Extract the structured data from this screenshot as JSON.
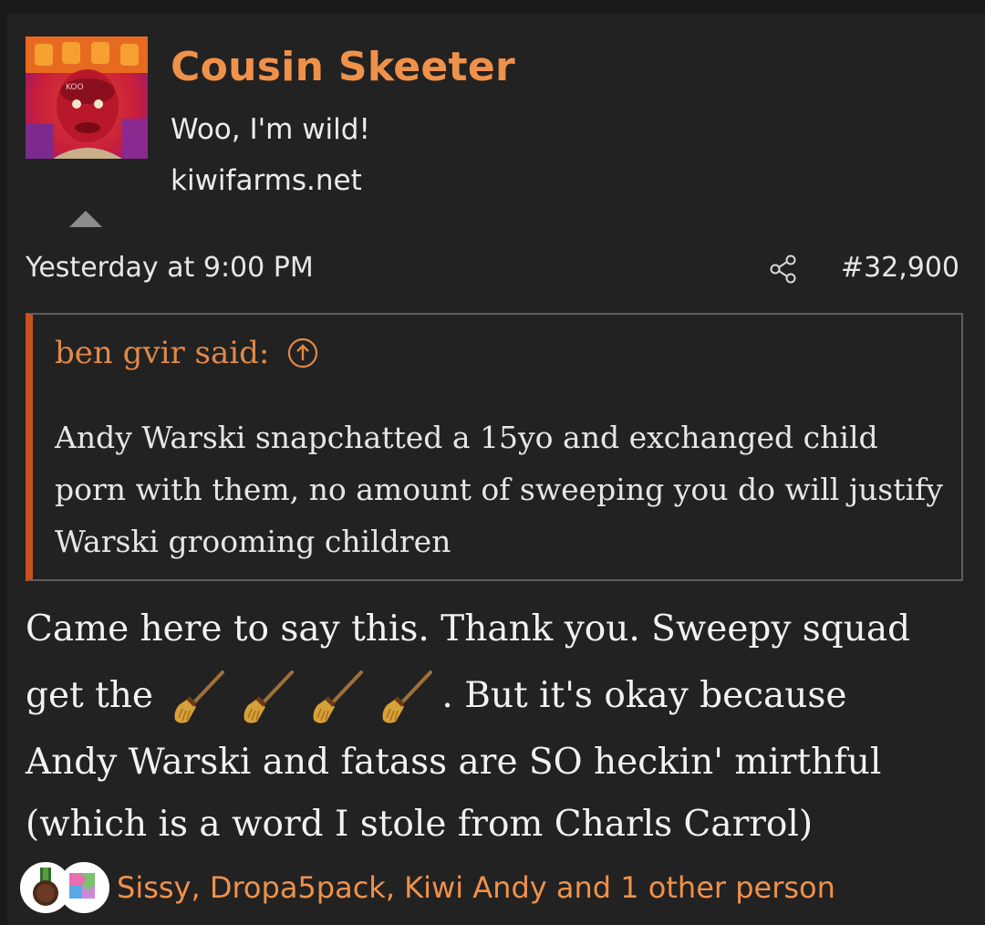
{
  "post": {
    "username": "Cousin Skeeter",
    "user_title": "Woo, I'm wild!",
    "user_site": "kiwifarms.net",
    "timestamp": "Yesterday at 9:00 PM",
    "post_number": "#32,900",
    "avatar_icon": "user-avatar",
    "share_icon": "share-icon"
  },
  "quote": {
    "author_said": "ben gvir said:",
    "jump_icon": "arrow-up-circle-icon",
    "text": "Andy Warski snapchatted a 15yo and exchanged child porn with them, no amount of sweeping you do will justify Warski grooming children",
    "accent_color": "#c9511e"
  },
  "body": {
    "line1": "Came here to say this. Thank you. Sweepy squad",
    "line2_start": "get the",
    "emoji_name": "broom-emoji",
    "emoji_count": 4,
    "line2_end": ". But it's okay because",
    "line3": "Andy Warski and fatass are SO heckin' mirthful",
    "line4": "(which is a word I stole from Charls Carrol)"
  },
  "reactions": {
    "summary": "Sissy, Dropa5pack, Kiwi Andy and 1 other person",
    "icons": [
      "medal-reaction-icon",
      "puzzle-reaction-icon"
    ]
  },
  "colors": {
    "accent": "#f0914a",
    "background": "#222222",
    "text": "#e6e6e6"
  }
}
